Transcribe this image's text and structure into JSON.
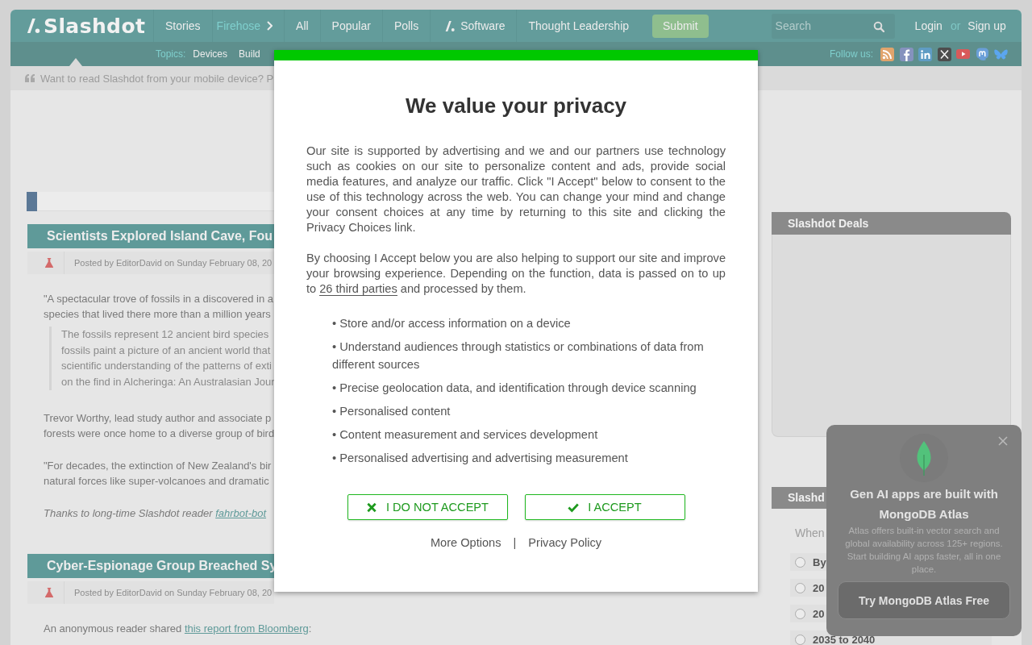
{
  "header": {
    "logo": "Slashdot",
    "nav": [
      {
        "label": "Stories",
        "kind": "plain"
      },
      {
        "label": "Firehose",
        "kind": "highlighted"
      },
      {
        "label": "All",
        "kind": "plain"
      },
      {
        "label": "Popular",
        "kind": "plain"
      },
      {
        "label": "Polls",
        "kind": "plain"
      },
      {
        "label": "Software",
        "kind": "branded"
      },
      {
        "label": "Thought Leadership",
        "kind": "plain"
      }
    ],
    "submit": "Submit",
    "search": {
      "placeholder": "Search"
    },
    "login": "Login",
    "or": "or",
    "signup": "Sign up"
  },
  "topics": {
    "label": "Topics:",
    "items": [
      "Devices",
      "Build"
    ]
  },
  "follow": {
    "label": "Follow us:"
  },
  "mobile_notice": "Want to read Slashdot from your mobile device? P",
  "stories": [
    {
      "title": "Scientists Explored Island Cave, Fou",
      "byline": "Posted by EditorDavid on Sunday February 08, 20",
      "body": [
        {
          "kind": "text",
          "text": "\"A spectacular trove of fossils in a discovered in a\nspecies that lived there more than a million years"
        },
        {
          "kind": "quote",
          "text": "The fossils represent 12 ancient bird species\nfossils paint a picture of an ancient world that\nscientific understanding of the patterns of exti\non the find in Alcheringa: An Australasian Jour"
        },
        {
          "kind": "text",
          "text": "Trevor Worthy, lead study author and associate p\nforests were once home to a diverse group of bird"
        },
        {
          "kind": "text",
          "text": "\"For decades, the extinction of New Zealand's bir\nnatural forces like super-volcanoes and dramatic"
        },
        {
          "kind": "credit",
          "before": "Thanks to long-time Slashdot reader ",
          "link": "fahrbot-bot"
        }
      ]
    },
    {
      "title": "Cyber-Espionage Group Breached Sy",
      "byline": "Posted by EditorDavid on Sunday February 08, 20",
      "body": [
        {
          "kind": "linked",
          "before": "An anonymous reader shared ",
          "link": "this report from Bloomberg",
          "after": ":"
        }
      ]
    }
  ],
  "sidebar": {
    "deals": {
      "title": "Slashdot Deals"
    },
    "poll": {
      "title": "Slashd",
      "question": "When",
      "options": [
        {
          "label": "By",
          "selected": false
        },
        {
          "label": "20",
          "selected": false
        },
        {
          "label": "20",
          "selected": false
        },
        {
          "label": "2035 to 2040",
          "selected": false
        }
      ]
    }
  },
  "promo": {
    "title": "Gen AI apps are built with MongoDB Atlas",
    "text": "Atlas offers built-in vector search and global availability across 125+ regions. Start building AI apps faster, all in one place.",
    "button": "Try MongoDB Atlas Free"
  },
  "consent": {
    "title": "We value your privacy",
    "intro": "Our site is supported by advertising and we and our partners use technology such as cookies on our site to personalize content and ads, provide social media features, and analyze our traffic. Click \"I Accept\" below to consent to the use of this technology across the web. You can change your mind and change your consent choices at any time by returning to this site and clicking the Privacy Choices link.",
    "partners": {
      "before": "By choosing I Accept below you are also helping to support our site and improve your browsing experience. Depending on the function, data is passed on to up to ",
      "link": "26 third parties",
      "after": " and processed by them."
    },
    "purposes": [
      "• Store and/or access information on a device",
      "• Understand audiences through statistics or combinations of data from different sources",
      "• Precise geolocation data, and identification through device scanning",
      "• Personalised content",
      "• Content measurement and services development",
      "• Personalised advertising and advertising measurement"
    ],
    "buttons": [
      {
        "label": "I DO NOT ACCEPT",
        "kind": "reject"
      },
      {
        "label": "I ACCEPT",
        "kind": "accept"
      }
    ],
    "links": [
      "More Options",
      "Privacy Policy"
    ],
    "separator": "|"
  }
}
